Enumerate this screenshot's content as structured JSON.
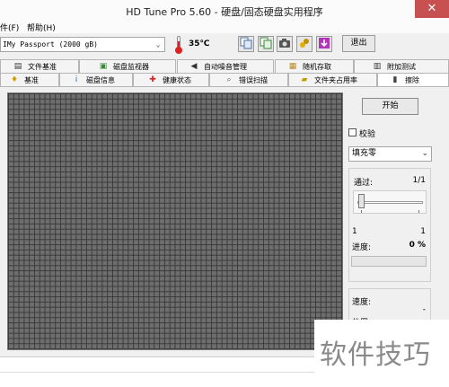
{
  "window": {
    "title": "HD Tune Pro 5.60 - 硬盘/固态硬盘实用程序",
    "close_glyph": "✕"
  },
  "menu": {
    "file": "件(F)",
    "help": "帮助(H)"
  },
  "toolbar": {
    "drive": "IMy Passport (2000 gB)",
    "temperature": "35℃",
    "exit_label": "退出",
    "icons": [
      "copy-info-icon",
      "copy-text-icon",
      "camera-icon",
      "options-icon",
      "save-icon"
    ]
  },
  "tabs_top": [
    {
      "label": "文件基准",
      "icon": "file-benchmark-icon"
    },
    {
      "label": "磁盘监视器",
      "icon": "disk-monitor-icon"
    },
    {
      "label": "自动噪音管理",
      "icon": "speaker-icon"
    },
    {
      "label": "随机存取",
      "icon": "random-access-icon"
    },
    {
      "label": "附加测试",
      "icon": "extra-tests-icon"
    }
  ],
  "tabs_bottom": [
    {
      "label": "基准",
      "icon": "benchmark-icon"
    },
    {
      "label": "磁盘信息",
      "icon": "info-icon"
    },
    {
      "label": "健康状态",
      "icon": "health-icon"
    },
    {
      "label": "错误扫描",
      "icon": "error-scan-icon"
    },
    {
      "label": "文件夹占用率",
      "icon": "folder-usage-icon"
    },
    {
      "label": "擦除",
      "icon": "erase-icon"
    }
  ],
  "erase": {
    "start_label": "开始",
    "verify_label": "校验",
    "verify_checked": false,
    "fill_option": "填充零",
    "pass_label": "通过:",
    "pass_value": "1/1",
    "slider_min": "1",
    "slider_max": "1",
    "progress_label": "进度:",
    "progress_value": "0 %",
    "progress": 0,
    "speed_label": "速度:",
    "speed_value": "-",
    "position_label": "位置:"
  },
  "watermark": "软件技巧",
  "colors": {
    "grid_block": "#6e6e6e",
    "progress_fill": "#37b44a",
    "close_button": "#c75050"
  }
}
